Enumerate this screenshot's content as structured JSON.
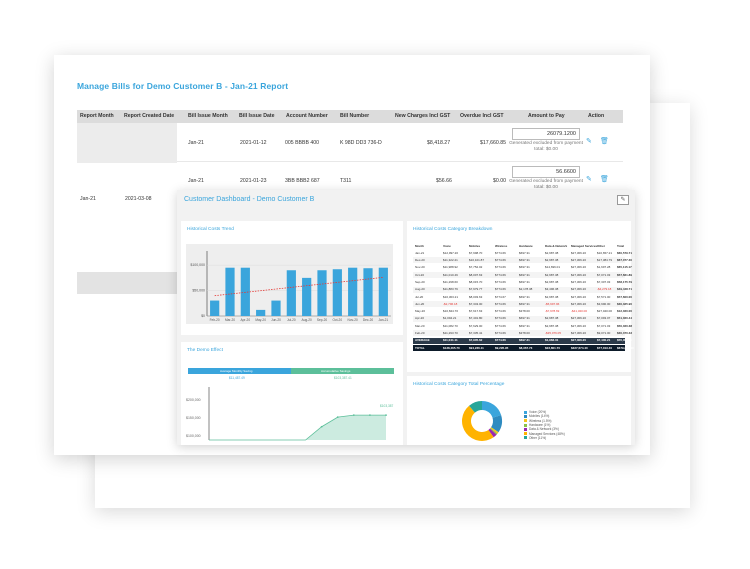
{
  "bills": {
    "title": "Manage Bills for Demo Customer B - Jan-21 Report",
    "columns": [
      "Report Month",
      "Report Created Date",
      "Bill Issue Month",
      "Bill Issue Date",
      "Account Number",
      "Bill Number",
      "New Charges Incl GST",
      "Overdue Incl GST",
      "Amount to Pay",
      "Action"
    ],
    "report_month": "Jan-21",
    "report_created": "2021-03-08",
    "rows": [
      {
        "issue_month": "Jan-21",
        "issue_date": "2021-01-12",
        "account": "005 BBBB 400",
        "bill": "K 98D DD3 736-D",
        "new_charges": "$8,418.27",
        "overdue": "$17,660.85",
        "amount": "26079.1200",
        "note": "Generated excluded from payment total: $0.00"
      },
      {
        "issue_month": "Jan-21",
        "issue_date": "2021-01-23",
        "account": "3BB BBB2 687",
        "bill": "T311",
        "new_charges": "$56.66",
        "overdue": "$0.00",
        "amount": "56.6600",
        "note": "Generated excluded from payment total: $0.00"
      }
    ]
  },
  "dashboard": {
    "title": "Customer Dashboard - Demo Customer B",
    "trend": {
      "title": "Historical Costs Trend"
    },
    "breakdown": {
      "title": "Historical Costs Category Breakdown",
      "headers": [
        "Month",
        "Voice",
        "Mobiles",
        "Wireless",
        "Hardware",
        "Data & Network",
        "Managed Services",
        "Other",
        "Total"
      ],
      "rows": [
        [
          "Jan-21",
          "$12,997.20",
          "$7,998.70",
          "$774.66",
          "$697.31",
          "$2,987.38",
          "$27,306.20",
          "$10,657.21",
          "$60,579.71"
        ],
        [
          "Dec-20",
          "$11,322.21",
          "$10,101.87",
          "$774.66",
          "$697.31",
          "$2,987.38",
          "$27,306.20",
          "$17,384.79",
          "$67,077.30"
        ],
        [
          "Nov-20",
          "$11,988.92",
          "$7,752.02",
          "$774.66",
          "$697.31",
          "$14,696.01",
          "$27,306.20",
          "$1,697.28",
          "$65,115.17"
        ],
        [
          "Oct-20",
          "$11,010.49",
          "$8,007.63",
          "$774.66",
          "$697.31",
          "$2,987.38",
          "$27,306.20",
          "$7,071.03",
          "$57,661.89"
        ],
        [
          "Sep-20",
          "$11,298.60",
          "$8,015.70",
          "$774.66",
          "$697.31",
          "$2,987.38",
          "$27,306.20",
          "$7,307.03",
          "$58,175.79"
        ],
        [
          "Aug-20",
          "$11,883.79",
          "$7,979.77",
          "$774.66",
          "$2,178.38",
          "$3,496.38",
          "$27,306.20",
          "-$4,279.18",
          "$49,448.71"
        ],
        [
          "Jul-20",
          "$10,303.21",
          "$8,003.63",
          "$774.67",
          "$697.31",
          "$2,987.38",
          "$27,306.20",
          "$7,571.00",
          "$57,600.00"
        ],
        [
          "Jun-20",
          "-$2,796.18",
          "$7,343.00",
          "$774.66",
          "$697.31",
          "-$5,997.96",
          "$27,306.20",
          "$3,990.00",
          "$30,325.90"
        ],
        [
          "May-20",
          "$10,844.70",
          "$7,617.63",
          "$774.66",
          "$378.00",
          "-$7,978.69",
          "-$41,320.00",
          "$27,040.00",
          "$12,020.00"
        ],
        [
          "Apr-20",
          "$1,094.21",
          "$7,401.80",
          "$774.66",
          "$697.31",
          "$2,987.38",
          "$27,306.20",
          "$7,093.07",
          "$51,020.44"
        ],
        [
          "Mar-20",
          "$11,082.70",
          "$7,629.00",
          "$774.66",
          "$697.31",
          "$2,987.38",
          "$27,306.20",
          "$7,071.03",
          "$50,020.38"
        ],
        [
          "Feb-20",
          "$11,293.70",
          "$7,335.41",
          "$774.66",
          "$378.00",
          "-$35,076.05",
          "$27,306.20",
          "$9,071.00",
          "$30,370.33"
        ]
      ],
      "average": [
        "AVERAGE",
        "$11,041.11",
        "$7,905.62",
        "$774.66",
        "$697.31",
        "$1,983.31",
        "$27,306.20",
        "$7,400.21",
        "$55,006.11"
      ],
      "total": [
        "TOTAL",
        "$138,465.70",
        "$94,236.11",
        "$9,295.95",
        "$8,367.73",
        "$23,801.70",
        "$327,674.40",
        "$77,013.40",
        "$679,855.40"
      ]
    },
    "demo_effect": {
      "title": "The Demo Effect",
      "left_label": "Average Monthly Saving",
      "left_value": "$11,487.49",
      "right_label": "Accumulative Savings",
      "right_value": "$103,387.41",
      "peak_label": "$103,387",
      "yticks": [
        "$200,000",
        "$150,000",
        "$100,000"
      ]
    },
    "percentage": {
      "title": "Historical Costs Category Total Percentage",
      "legend": [
        {
          "label": "Voice (20%)",
          "color": "#3aa5dc"
        },
        {
          "label": "Mobiles (14%)",
          "color": "#2e8bc0"
        },
        {
          "label": "Wireless (1.5%)",
          "color": "#f5c518"
        },
        {
          "label": "Hardware (1%)",
          "color": "#8bc34a"
        },
        {
          "label": "Data & Network (3%)",
          "color": "#9c27b0"
        },
        {
          "label": "Managed Services (48%)",
          "color": "#ffb300"
        },
        {
          "label": "Other (11%)",
          "color": "#26a69a"
        }
      ]
    }
  },
  "chart_data": [
    {
      "type": "bar",
      "title": "Historical Costs Trend",
      "categories": [
        "Feb-20",
        "Mar-20",
        "Apr-20",
        "May-20",
        "Jun-20",
        "Jul-20",
        "Aug-20",
        "Sep-20",
        "Oct-20",
        "Nov-20",
        "Dec-20",
        "Jan-21"
      ],
      "values": [
        30370,
        95000,
        95000,
        12020,
        30326,
        90000,
        75000,
        90000,
        92000,
        95000,
        94000,
        95000
      ],
      "trendline": [
        40000,
        76000
      ],
      "yticks": [
        "$100,000",
        "$50,000",
        "$0"
      ],
      "ylim": [
        0,
        120000
      ],
      "colors": {
        "bar": "#3aa5dc",
        "trend": "#e53935"
      }
    },
    {
      "type": "area",
      "title": "The Demo Effect",
      "x": [
        "Feb-20",
        "Mar-20",
        "Apr-20",
        "May-20",
        "Jun-20",
        "Jul-20",
        "Aug-20",
        "Sep-20",
        "Oct-20",
        "Nov-20",
        "Dec-20",
        "Jan-21"
      ],
      "values": [
        0,
        0,
        0,
        0,
        0,
        0,
        0,
        55000,
        95000,
        103387,
        103387,
        103387
      ],
      "ylim": [
        0,
        220000
      ],
      "colors": {
        "fill": "#bfe6d8",
        "line": "#5cbf9a"
      }
    },
    {
      "type": "pie",
      "title": "Historical Costs Category Total Percentage",
      "labels": [
        "Voice",
        "Mobiles",
        "Wireless",
        "Hardware",
        "Data & Network",
        "Managed Services",
        "Other"
      ],
      "values": [
        20,
        14,
        1.5,
        1,
        3,
        48,
        11
      ]
    }
  ]
}
